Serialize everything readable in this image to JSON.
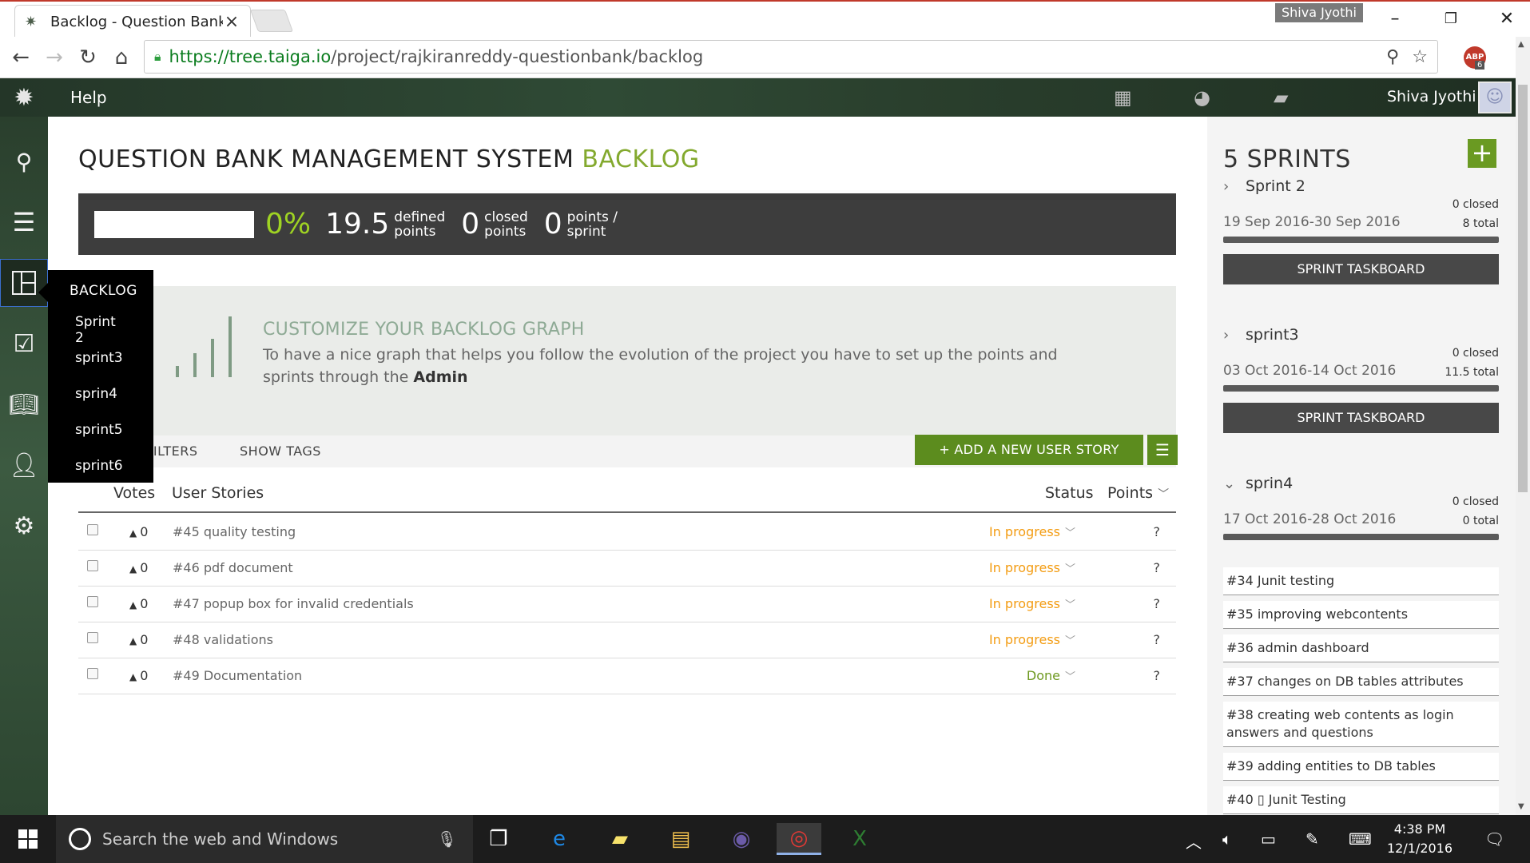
{
  "browser": {
    "tab_title": "Backlog - Question Bank",
    "profile_name": "Shiva Jyothi",
    "url_host": "https://tree.taiga.io",
    "url_path": "/project/rajkiranreddy-questionbank/backlog",
    "abp_count": "6"
  },
  "topbar": {
    "help_label": "Help",
    "user_name": "Shiva Jyothi"
  },
  "popmenu": {
    "title": "BACKLOG",
    "items": [
      "Sprint 2",
      "sprint3",
      "sprin4",
      "sprint5",
      "sprint6"
    ]
  },
  "page": {
    "title": "QUESTION BANK MANAGEMENT SYSTEM",
    "title_accent": "BACKLOG"
  },
  "summary": {
    "percent": "0%",
    "defined_points": "19.5",
    "defined_label_1": "defined",
    "defined_label_2": "points",
    "closed_points": "0",
    "closed_label_1": "closed",
    "closed_label_2": "points",
    "points_sprint": "0",
    "points_sprint_label_1": "points /",
    "points_sprint_label_2": "sprint"
  },
  "graph_box": {
    "heading": "CUSTOMIZE YOUR BACKLOG GRAPH",
    "text": "To have a nice graph that helps you follow the evolution of the project you have to set up the points and sprints through the",
    "admin_link": "Admin"
  },
  "filters": {
    "show_filters": "SHOW FILTERS",
    "show_tags": "SHOW TAGS",
    "add_story": "+ ADD A NEW USER STORY"
  },
  "table": {
    "headers": {
      "votes": "Votes",
      "stories": "User Stories",
      "status": "Status",
      "points": "Points"
    },
    "rows": [
      {
        "votes": "0",
        "story": "#45 quality testing",
        "status": "In progress",
        "points": "?"
      },
      {
        "votes": "0",
        "story": "#46 pdf document",
        "status": "In progress",
        "points": "?"
      },
      {
        "votes": "0",
        "story": "#47 popup box for invalid credentials",
        "status": "In progress",
        "points": "?"
      },
      {
        "votes": "0",
        "story": "#48 validations",
        "status": "In progress",
        "points": "?"
      },
      {
        "votes": "0",
        "story": "#49 Documentation",
        "status": "Done",
        "points": "?"
      }
    ]
  },
  "sprints": {
    "title": "5 SPRINTS",
    "list": [
      {
        "name": "Sprint 2",
        "closed": "0 closed",
        "total": "8 total",
        "dates": "19 Sep 2016-30 Sep 2016",
        "button": "SPRINT TASKBOARD"
      },
      {
        "name": "sprint3",
        "closed": "0 closed",
        "total": "11.5 total",
        "dates": "03 Oct 2016-14 Oct 2016",
        "button": "SPRINT TASKBOARD"
      },
      {
        "name": "sprin4",
        "closed": "0 closed",
        "total": "0 total",
        "dates": "17 Oct 2016-28 Oct 2016"
      }
    ],
    "stories": [
      "#34 Junit testing",
      "#35 improving webcontents",
      "#36 admin dashboard",
      "#37 changes on DB tables attributes",
      "#38 creating web contents as login answers and questions",
      "#39 adding entities to DB tables",
      "#40 ▯ Junit Testing"
    ]
  },
  "taskbar": {
    "search_placeholder": "Search the web and Windows",
    "time": "4:38 PM",
    "date": "12/1/2016"
  },
  "colors": {
    "accent_green": "#83a92e",
    "status_in_progress": "#f39c12",
    "status_done": "#6f9a22",
    "button_green": "#5c8c1e"
  }
}
